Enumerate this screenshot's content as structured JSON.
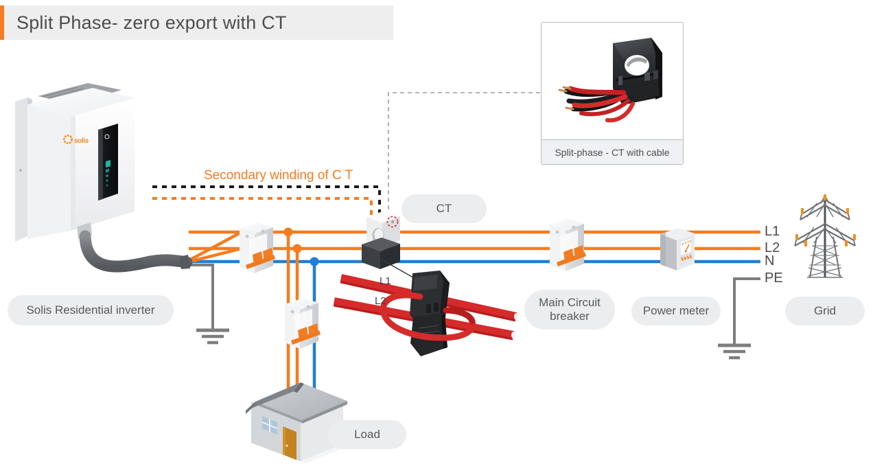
{
  "title": {
    "text": "Split Phase- zero export with CT",
    "accent_color": "#f57c20",
    "bar_bg": "#eeeeee"
  },
  "colors": {
    "line_L1": "#f57c20",
    "line_L2": "#f57c20",
    "line_N": "#1e7fd4",
    "line_PE": "#7d7d7d",
    "pill_bg": "#ecedef",
    "pill_text": "#555a5e",
    "secondary_winding_text": "#f57c20",
    "ct_detail_conductor": "#d62b2b"
  },
  "annotations": {
    "secondary_winding": "Secondary winding of C T",
    "ct_detail_L1": "L1",
    "ct_detail_L2": "L2"
  },
  "inset": {
    "caption": "Split-phase - CT with cable"
  },
  "bus_labels": [
    {
      "id": "L1",
      "label": "L1"
    },
    {
      "id": "L2",
      "label": "L2"
    },
    {
      "id": "N",
      "label": "N"
    },
    {
      "id": "PE",
      "label": "PE"
    }
  ],
  "device_labels": {
    "inverter": "Solis Residential inverter",
    "ct": "CT",
    "main_breaker_line1": "Main Circuit",
    "main_breaker_line2": "breaker",
    "power_meter": "Power meter",
    "grid": "Grid",
    "load": "Load"
  },
  "inverter": {
    "brand": "solis"
  }
}
